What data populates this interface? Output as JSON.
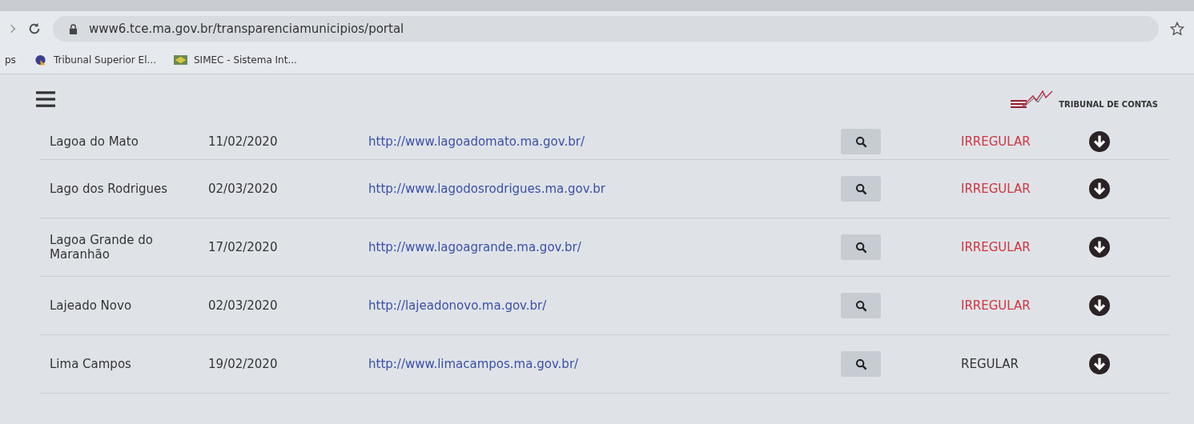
{
  "browser": {
    "url": "www6.tce.ma.gov.br/transparenciamunicipios/portal",
    "apps_label": "ps",
    "bookmarks": [
      "Tribunal Superior El...",
      "SIMEC - Sistema Int..."
    ]
  },
  "header": {
    "logo_text": "TRIBUNAL DE CONTAS"
  },
  "rows": [
    {
      "municipality": "Lagoa do Mato",
      "date": "11/02/2020",
      "url": "http://www.lagoadomato.ma.gov.br/",
      "status": "IRREGULAR",
      "irregular": true
    },
    {
      "municipality": "Lago dos Rodrigues",
      "date": "02/03/2020",
      "url": "http://www.lagodosrodrigues.ma.gov.br",
      "status": "IRREGULAR",
      "irregular": true
    },
    {
      "municipality": "Lagoa Grande do Maranhão",
      "date": "17/02/2020",
      "url": "http://www.lagoagrande.ma.gov.br/",
      "status": "IRREGULAR",
      "irregular": true
    },
    {
      "municipality": "Lajeado Novo",
      "date": "02/03/2020",
      "url": "http://lajeadonovo.ma.gov.br/",
      "status": "IRREGULAR",
      "irregular": true
    },
    {
      "municipality": "Lima Campos",
      "date": "19/02/2020",
      "url": "http://www.limacampos.ma.gov.br/",
      "status": "REGULAR",
      "irregular": false
    }
  ]
}
